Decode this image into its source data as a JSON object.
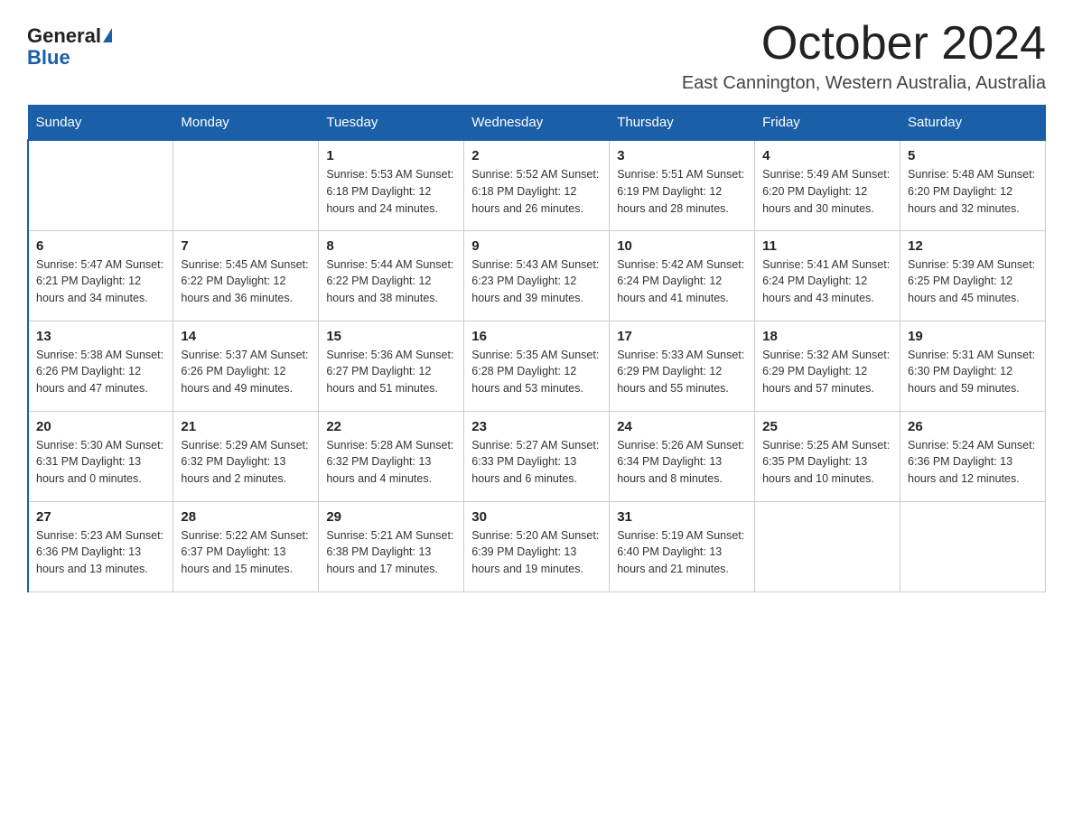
{
  "header": {
    "logo_general": "General",
    "logo_blue": "Blue",
    "title": "October 2024",
    "subtitle": "East Cannington, Western Australia, Australia"
  },
  "days_of_week": [
    "Sunday",
    "Monday",
    "Tuesday",
    "Wednesday",
    "Thursday",
    "Friday",
    "Saturday"
  ],
  "weeks": [
    [
      {
        "day": "",
        "info": ""
      },
      {
        "day": "",
        "info": ""
      },
      {
        "day": "1",
        "info": "Sunrise: 5:53 AM\nSunset: 6:18 PM\nDaylight: 12 hours\nand 24 minutes."
      },
      {
        "day": "2",
        "info": "Sunrise: 5:52 AM\nSunset: 6:18 PM\nDaylight: 12 hours\nand 26 minutes."
      },
      {
        "day": "3",
        "info": "Sunrise: 5:51 AM\nSunset: 6:19 PM\nDaylight: 12 hours\nand 28 minutes."
      },
      {
        "day": "4",
        "info": "Sunrise: 5:49 AM\nSunset: 6:20 PM\nDaylight: 12 hours\nand 30 minutes."
      },
      {
        "day": "5",
        "info": "Sunrise: 5:48 AM\nSunset: 6:20 PM\nDaylight: 12 hours\nand 32 minutes."
      }
    ],
    [
      {
        "day": "6",
        "info": "Sunrise: 5:47 AM\nSunset: 6:21 PM\nDaylight: 12 hours\nand 34 minutes."
      },
      {
        "day": "7",
        "info": "Sunrise: 5:45 AM\nSunset: 6:22 PM\nDaylight: 12 hours\nand 36 minutes."
      },
      {
        "day": "8",
        "info": "Sunrise: 5:44 AM\nSunset: 6:22 PM\nDaylight: 12 hours\nand 38 minutes."
      },
      {
        "day": "9",
        "info": "Sunrise: 5:43 AM\nSunset: 6:23 PM\nDaylight: 12 hours\nand 39 minutes."
      },
      {
        "day": "10",
        "info": "Sunrise: 5:42 AM\nSunset: 6:24 PM\nDaylight: 12 hours\nand 41 minutes."
      },
      {
        "day": "11",
        "info": "Sunrise: 5:41 AM\nSunset: 6:24 PM\nDaylight: 12 hours\nand 43 minutes."
      },
      {
        "day": "12",
        "info": "Sunrise: 5:39 AM\nSunset: 6:25 PM\nDaylight: 12 hours\nand 45 minutes."
      }
    ],
    [
      {
        "day": "13",
        "info": "Sunrise: 5:38 AM\nSunset: 6:26 PM\nDaylight: 12 hours\nand 47 minutes."
      },
      {
        "day": "14",
        "info": "Sunrise: 5:37 AM\nSunset: 6:26 PM\nDaylight: 12 hours\nand 49 minutes."
      },
      {
        "day": "15",
        "info": "Sunrise: 5:36 AM\nSunset: 6:27 PM\nDaylight: 12 hours\nand 51 minutes."
      },
      {
        "day": "16",
        "info": "Sunrise: 5:35 AM\nSunset: 6:28 PM\nDaylight: 12 hours\nand 53 minutes."
      },
      {
        "day": "17",
        "info": "Sunrise: 5:33 AM\nSunset: 6:29 PM\nDaylight: 12 hours\nand 55 minutes."
      },
      {
        "day": "18",
        "info": "Sunrise: 5:32 AM\nSunset: 6:29 PM\nDaylight: 12 hours\nand 57 minutes."
      },
      {
        "day": "19",
        "info": "Sunrise: 5:31 AM\nSunset: 6:30 PM\nDaylight: 12 hours\nand 59 minutes."
      }
    ],
    [
      {
        "day": "20",
        "info": "Sunrise: 5:30 AM\nSunset: 6:31 PM\nDaylight: 13 hours\nand 0 minutes."
      },
      {
        "day": "21",
        "info": "Sunrise: 5:29 AM\nSunset: 6:32 PM\nDaylight: 13 hours\nand 2 minutes."
      },
      {
        "day": "22",
        "info": "Sunrise: 5:28 AM\nSunset: 6:32 PM\nDaylight: 13 hours\nand 4 minutes."
      },
      {
        "day": "23",
        "info": "Sunrise: 5:27 AM\nSunset: 6:33 PM\nDaylight: 13 hours\nand 6 minutes."
      },
      {
        "day": "24",
        "info": "Sunrise: 5:26 AM\nSunset: 6:34 PM\nDaylight: 13 hours\nand 8 minutes."
      },
      {
        "day": "25",
        "info": "Sunrise: 5:25 AM\nSunset: 6:35 PM\nDaylight: 13 hours\nand 10 minutes."
      },
      {
        "day": "26",
        "info": "Sunrise: 5:24 AM\nSunset: 6:36 PM\nDaylight: 13 hours\nand 12 minutes."
      }
    ],
    [
      {
        "day": "27",
        "info": "Sunrise: 5:23 AM\nSunset: 6:36 PM\nDaylight: 13 hours\nand 13 minutes."
      },
      {
        "day": "28",
        "info": "Sunrise: 5:22 AM\nSunset: 6:37 PM\nDaylight: 13 hours\nand 15 minutes."
      },
      {
        "day": "29",
        "info": "Sunrise: 5:21 AM\nSunset: 6:38 PM\nDaylight: 13 hours\nand 17 minutes."
      },
      {
        "day": "30",
        "info": "Sunrise: 5:20 AM\nSunset: 6:39 PM\nDaylight: 13 hours\nand 19 minutes."
      },
      {
        "day": "31",
        "info": "Sunrise: 5:19 AM\nSunset: 6:40 PM\nDaylight: 13 hours\nand 21 minutes."
      },
      {
        "day": "",
        "info": ""
      },
      {
        "day": "",
        "info": ""
      }
    ]
  ]
}
